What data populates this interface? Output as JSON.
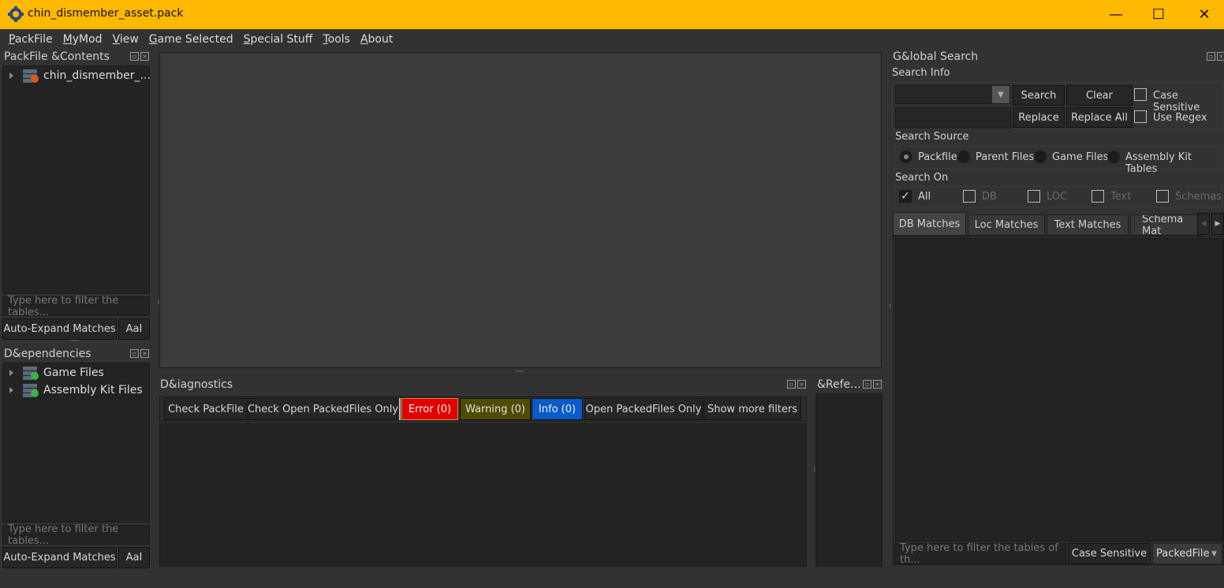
{
  "window": {
    "title": "chin_dismember_asset.pack",
    "app_icon": "rpfm-gear-icon",
    "controls": {
      "minimize": "—",
      "maximize": "☐",
      "close": "✕"
    },
    "accent": "#ffb900"
  },
  "menubar": [
    {
      "mn": "P",
      "rest": "ackFile"
    },
    {
      "mn": "M",
      "rest": "yMod"
    },
    {
      "mn": "V",
      "rest": "iew"
    },
    {
      "mn": "G",
      "rest": "ame Selected"
    },
    {
      "mn": "S",
      "rest": "pecial Stuff"
    },
    {
      "mn": "T",
      "rest": "ools"
    },
    {
      "mn": "A",
      "rest": "bout"
    }
  ],
  "packfile_contents": {
    "title": "PackFile &Contents",
    "tree": [
      {
        "label": "chin_dismember_...",
        "icon": "packfile-icon",
        "badge_color": "#e05a1a"
      }
    ],
    "filter_placeholder": "Type here to filter the tables...",
    "auto_expand_label": "Auto-Expand Matches",
    "case_label": "AaI"
  },
  "dependencies": {
    "title": "D&ependencies",
    "tree": [
      {
        "label": "Game Files",
        "icon": "database-lock-icon",
        "badge_color": "#3ab34a"
      },
      {
        "label": "Assembly Kit Files",
        "icon": "database-lock-icon",
        "badge_color": "#3ab34a"
      }
    ],
    "filter_placeholder": "Type here to filter the tables...",
    "auto_expand_label": "Auto-Expand Matches",
    "case_label": "AaI"
  },
  "diagnostics": {
    "title": "D&iagnostics",
    "buttons": {
      "check_packfile": "Check PackFile",
      "check_open": "Check Open PackedFiles Only",
      "error": "Error (0)",
      "warning": "Warning (0)",
      "info": "Info (0)",
      "open_only": "Open PackedFiles Only",
      "more_filters": "Show more filters"
    },
    "colors": {
      "error": "#e00000",
      "warning": "#4e4c00",
      "info": "#0a5ac8"
    }
  },
  "references": {
    "title": "&Refe..."
  },
  "global_search": {
    "title": "G&lobal Search",
    "search_info_label": "Search Info",
    "search_value": "",
    "replace_value": "",
    "search_btn": "Search",
    "clear_btn": "Clear",
    "replace_btn": "Replace",
    "replace_all_btn": "Replace All",
    "case_sensitive": {
      "label": "Case Sensitive",
      "checked": false
    },
    "use_regex": {
      "label": "Use Regex",
      "checked": false
    },
    "search_source_label": "Search Source",
    "sources": [
      {
        "label": "Packfile",
        "selected": true
      },
      {
        "label": "Parent Files",
        "selected": false
      },
      {
        "label": "Game Files",
        "selected": false
      },
      {
        "label": "Assembly Kit Tables",
        "selected": false
      }
    ],
    "search_on_label": "Search On",
    "search_on": [
      {
        "label": "All",
        "checked": true,
        "enabled": true
      },
      {
        "label": "DB",
        "checked": false,
        "enabled": false
      },
      {
        "label": "LOC",
        "checked": false,
        "enabled": false
      },
      {
        "label": "Text",
        "checked": false,
        "enabled": false
      },
      {
        "label": "Schemas",
        "checked": false,
        "enabled": false
      }
    ],
    "tabs": [
      "DB Matches",
      "Loc Matches",
      "Text Matches",
      "Schema Mat"
    ],
    "active_tab": "DB Matches",
    "filter_placeholder": "Type here to filter the tables of th...",
    "filter_case_btn": "Case Sensitive",
    "filter_scope": "PackedFile"
  }
}
